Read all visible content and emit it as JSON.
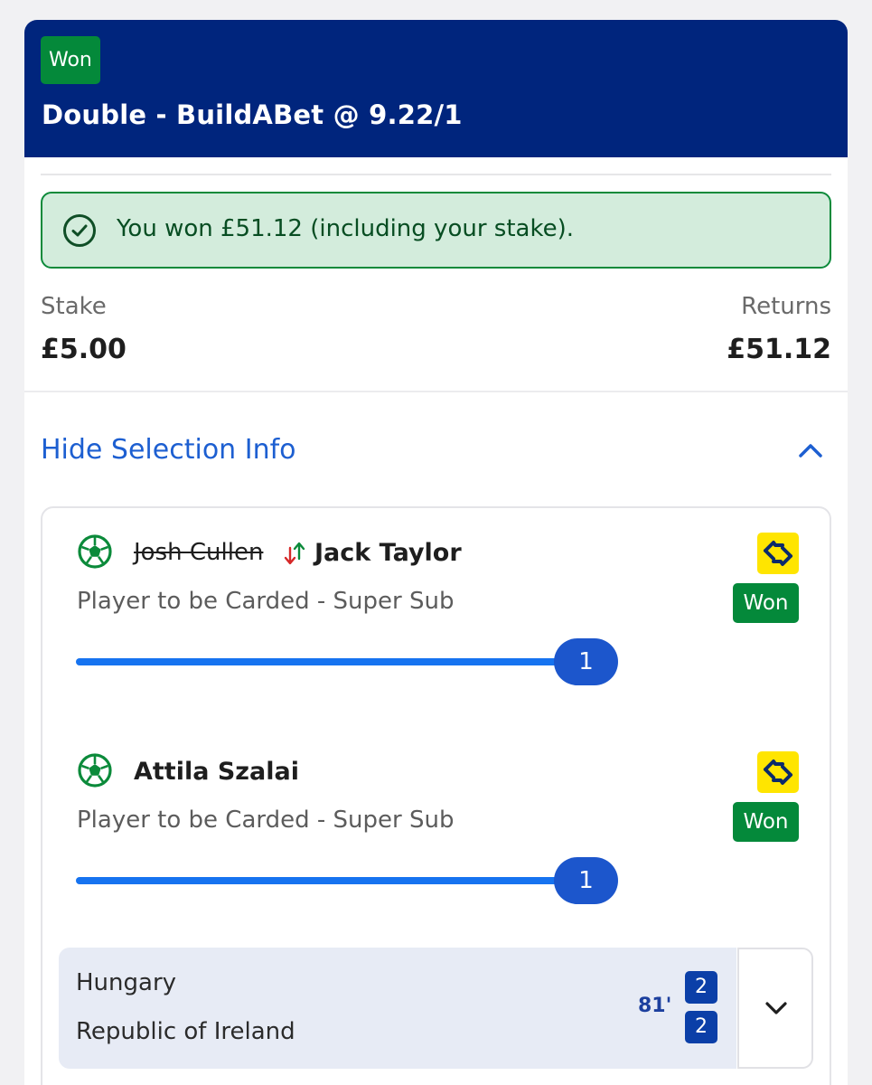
{
  "bet": {
    "status": "Won",
    "title": "Double - BuildABet @ 9.22/1"
  },
  "result_banner": {
    "text": "You won £51.12 (including your stake).",
    "icon": "check-circle-icon"
  },
  "stake": {
    "label": "Stake",
    "value": "£5.00"
  },
  "returns": {
    "label": "Returns",
    "value": "£51.12"
  },
  "selection_toggle": {
    "label": "Hide Selection Info",
    "icon": "chevron-up-icon"
  },
  "legs": [
    {
      "replaced_player": "Josh Cullen",
      "player": "Jack Taylor",
      "market": "Player to be Carded - Super Sub",
      "status": "Won",
      "progress_value": "1",
      "icons": [
        "football-icon",
        "substitution-icon",
        "swap-icon"
      ]
    },
    {
      "player": "Attila Szalai",
      "market": "Player to be Carded - Super Sub",
      "status": "Won",
      "progress_value": "1",
      "icons": [
        "football-icon",
        "swap-icon"
      ]
    }
  ],
  "event": {
    "home_team": "Hungary",
    "away_team": "Republic of Ireland",
    "minute": "81'",
    "home_score": "2",
    "away_score": "2"
  },
  "colors": {
    "header_bg": "#00257d",
    "won_green": "#04893a",
    "banner_bg": "#d3ecdc",
    "link_blue": "#1d5fd1",
    "progress_blue": "#1673f0",
    "badge_yellow": "#ffe500"
  }
}
